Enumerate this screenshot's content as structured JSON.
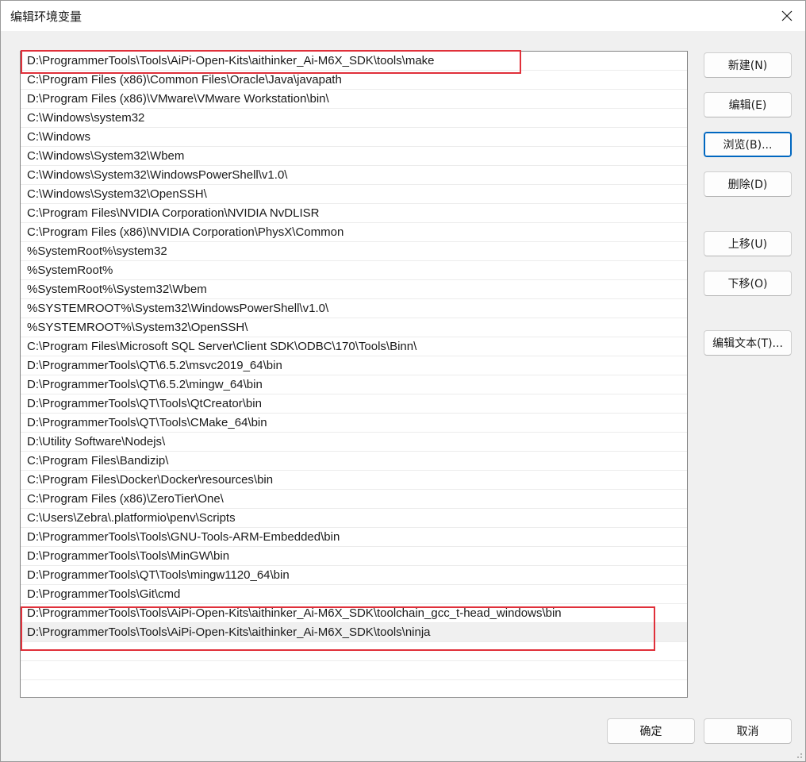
{
  "window": {
    "title": "编辑环境变量",
    "close_icon": "close-icon"
  },
  "paths": [
    "D:\\ProgrammerTools\\Tools\\AiPi-Open-Kits\\aithinker_Ai-M6X_SDK\\tools\\make",
    "C:\\Program Files (x86)\\Common Files\\Oracle\\Java\\javapath",
    "D:\\Program Files (x86)\\VMware\\VMware Workstation\\bin\\",
    "C:\\Windows\\system32",
    "C:\\Windows",
    "C:\\Windows\\System32\\Wbem",
    "C:\\Windows\\System32\\WindowsPowerShell\\v1.0\\",
    "C:\\Windows\\System32\\OpenSSH\\",
    "C:\\Program Files\\NVIDIA Corporation\\NVIDIA NvDLISR",
    "C:\\Program Files (x86)\\NVIDIA Corporation\\PhysX\\Common",
    "%SystemRoot%\\system32",
    "%SystemRoot%",
    "%SystemRoot%\\System32\\Wbem",
    "%SYSTEMROOT%\\System32\\WindowsPowerShell\\v1.0\\",
    "%SYSTEMROOT%\\System32\\OpenSSH\\",
    "C:\\Program Files\\Microsoft SQL Server\\Client SDK\\ODBC\\170\\Tools\\Binn\\",
    "D:\\ProgrammerTools\\QT\\6.5.2\\msvc2019_64\\bin",
    "D:\\ProgrammerTools\\QT\\6.5.2\\mingw_64\\bin",
    "D:\\ProgrammerTools\\QT\\Tools\\QtCreator\\bin",
    "D:\\ProgrammerTools\\QT\\Tools\\CMake_64\\bin",
    "D:\\Utility Software\\Nodejs\\",
    "C:\\Program Files\\Bandizip\\",
    "C:\\Program Files\\Docker\\Docker\\resources\\bin",
    "C:\\Program Files (x86)\\ZeroTier\\One\\",
    "C:\\Users\\Zebra\\.platformio\\penv\\Scripts",
    "D:\\ProgrammerTools\\Tools\\GNU-Tools-ARM-Embedded\\bin",
    "D:\\ProgrammerTools\\Tools\\MinGW\\bin",
    "D:\\ProgrammerTools\\QT\\Tools\\mingw1120_64\\bin",
    "D:\\ProgrammerTools\\Git\\cmd",
    "D:\\ProgrammerTools\\Tools\\AiPi-Open-Kits\\aithinker_Ai-M6X_SDK\\toolchain_gcc_t-head_windows\\bin",
    "D:\\ProgrammerTools\\Tools\\AiPi-Open-Kits\\aithinker_Ai-M6X_SDK\\tools\\ninja",
    "",
    ""
  ],
  "selected_index": 30,
  "highlight_color": "#e0303a",
  "side_buttons": {
    "new": "新建(N)",
    "edit": "编辑(E)",
    "browse": "浏览(B)...",
    "delete": "删除(D)",
    "move_up": "上移(U)",
    "move_down": "下移(O)",
    "edit_text": "编辑文本(T)..."
  },
  "footer": {
    "ok": "确定",
    "cancel": "取消"
  }
}
